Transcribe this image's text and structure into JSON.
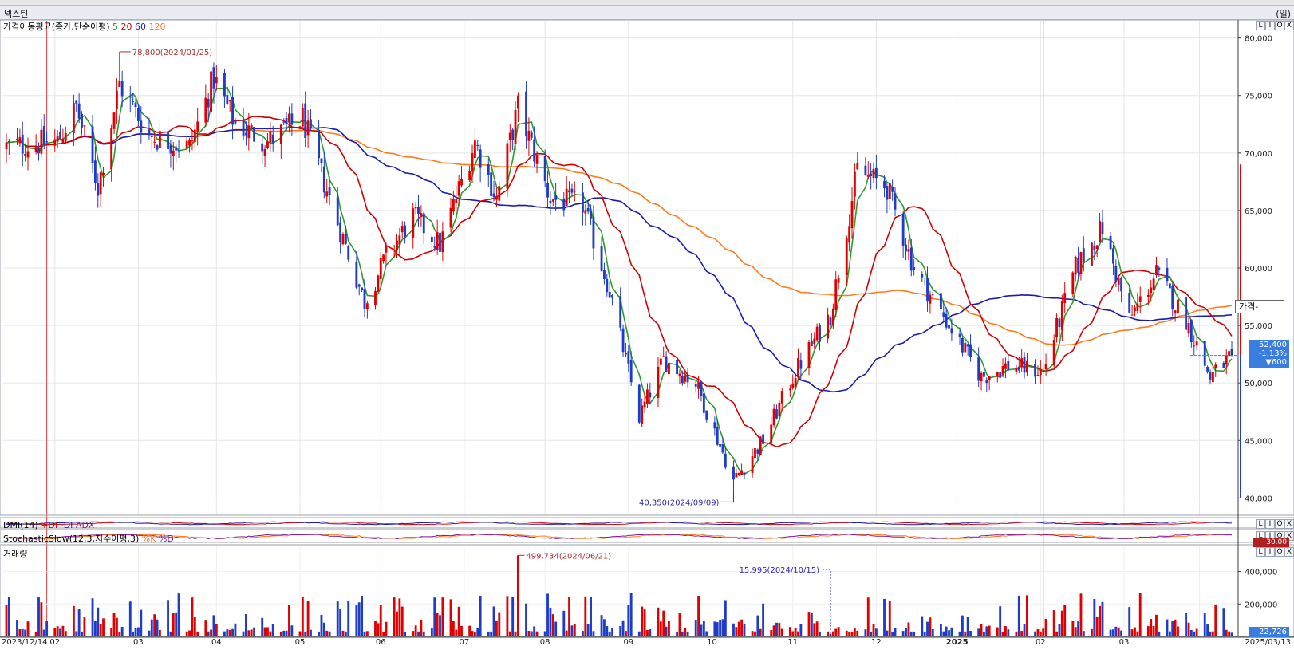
{
  "window": {
    "title": "넥스틴",
    "unit": "(일)"
  },
  "ma_header": {
    "label": "가격이동평균(종가,단순이평)",
    "periods": [
      "5",
      "20",
      "60",
      "120"
    ],
    "period_colors": [
      "#2e9b2e",
      "#d40000",
      "#1a1ab4",
      "#ff7a1a"
    ]
  },
  "price_panel": {
    "axis_ticks": [
      "80,000",
      "75,000",
      "70,000",
      "65,000",
      "60,000",
      "55,000",
      "50,000",
      "45,000",
      "40,000"
    ],
    "high_annotation": "78,800(2024/01/25)",
    "low_annotation": "40,350(2024/09/09)",
    "current": {
      "price": "52,400",
      "change_pct": "-1.13%",
      "change": "▼600"
    },
    "popup": "가격-"
  },
  "dmi_panel": {
    "label": "DMI(14)",
    "series": [
      "+DI",
      "-DI",
      "ADX"
    ],
    "series_colors": [
      "#d40000",
      "#1a1ab4",
      "#8a1a8a"
    ]
  },
  "stoch_panel": {
    "label": "StochasticSlow(12,3,지수이평,3)",
    "series": [
      "%K",
      "%D"
    ],
    "series_colors": [
      "#ff7a1a",
      "#8a1a8a"
    ],
    "value": "30.00"
  },
  "volume_panel": {
    "label": "거래량",
    "axis_ticks": [
      "400,000",
      "200,000"
    ],
    "max_annotation": "499,734(2024/06/21)",
    "min_annotation": "15,995(2024/10/15)",
    "current": "22,726"
  },
  "x_axis": {
    "labels": [
      "2023/12/14",
      "02",
      "03",
      "04",
      "05",
      "06",
      "07",
      "08",
      "09",
      "10",
      "11",
      "12",
      "2025",
      "02",
      "03",
      "2025/03/13"
    ]
  },
  "panel_controls": [
    "L",
    "I",
    "O",
    "X"
  ],
  "chart_data": {
    "type": "candlestick",
    "title": "넥스틴",
    "x_range": [
      "2023/12/14",
      "2025/03/13"
    ],
    "ylim": [
      38500,
      81500
    ],
    "colors": {
      "up": "#e00000",
      "down": "#1e3cc8",
      "ma5": "#2e9b2e",
      "ma20": "#d40000",
      "ma60": "#1a1ab4",
      "ma120": "#ff7a1a"
    },
    "price_anchors": [
      {
        "date": "2023-12-14",
        "close": 70500
      },
      {
        "date": "2024-01-02",
        "close": 71000
      },
      {
        "date": "2024-01-09",
        "close": 74000
      },
      {
        "date": "2024-01-17",
        "close": 67000
      },
      {
        "date": "2024-01-25",
        "close": 76000
      },
      {
        "date": "2024-02-05",
        "close": 71500
      },
      {
        "date": "2024-02-20",
        "close": 70500
      },
      {
        "date": "2024-02-29",
        "close": 76500
      },
      {
        "date": "2024-03-08",
        "close": 72500
      },
      {
        "date": "2024-03-20",
        "close": 71000
      },
      {
        "date": "2024-04-02",
        "close": 73000
      },
      {
        "date": "2024-04-15",
        "close": 64000
      },
      {
        "date": "2024-04-25",
        "close": 57000
      },
      {
        "date": "2024-05-03",
        "close": 61000
      },
      {
        "date": "2024-05-13",
        "close": 64500
      },
      {
        "date": "2024-05-23",
        "close": 62000
      },
      {
        "date": "2024-06-05",
        "close": 71000
      },
      {
        "date": "2024-06-13",
        "close": 66000
      },
      {
        "date": "2024-06-21",
        "close": 74000
      },
      {
        "date": "2024-07-03",
        "close": 66000
      },
      {
        "date": "2024-07-15",
        "close": 65500
      },
      {
        "date": "2024-07-25",
        "close": 58000
      },
      {
        "date": "2024-08-05",
        "close": 47000
      },
      {
        "date": "2024-08-14",
        "close": 52000
      },
      {
        "date": "2024-08-26",
        "close": 50000
      },
      {
        "date": "2024-09-09",
        "close": 41500
      },
      {
        "date": "2024-09-20",
        "close": 45000
      },
      {
        "date": "2024-10-02",
        "close": 51000
      },
      {
        "date": "2024-10-15",
        "close": 56000
      },
      {
        "date": "2024-10-25",
        "close": 68500
      },
      {
        "date": "2024-11-05",
        "close": 67000
      },
      {
        "date": "2024-11-15",
        "close": 60000
      },
      {
        "date": "2024-11-28",
        "close": 55000
      },
      {
        "date": "2024-12-10",
        "close": 50500
      },
      {
        "date": "2024-12-20",
        "close": 51500
      },
      {
        "date": "2025-01-02",
        "close": 51000
      },
      {
        "date": "2025-01-14",
        "close": 60000
      },
      {
        "date": "2025-01-24",
        "close": 63500
      },
      {
        "date": "2025-02-03",
        "close": 55500
      },
      {
        "date": "2025-02-13",
        "close": 59500
      },
      {
        "date": "2025-02-24",
        "close": 55500
      },
      {
        "date": "2025-03-05",
        "close": 50500
      },
      {
        "date": "2025-03-13",
        "close": 52400
      }
    ],
    "annotations": [
      {
        "label": "78,800(2024/01/25)",
        "date": "2024-01-25",
        "value": 78800
      },
      {
        "label": "40,350(2024/09/09)",
        "date": "2024-09-09",
        "value": 40350
      }
    ],
    "current_price": 52400,
    "change_pct": -1.13,
    "volume": {
      "ylim": [
        0,
        560000
      ],
      "max": {
        "date": "2024-06-21",
        "value": 499734
      },
      "min": {
        "date": "2024-10-15",
        "value": 15995
      },
      "last": 22726
    }
  }
}
